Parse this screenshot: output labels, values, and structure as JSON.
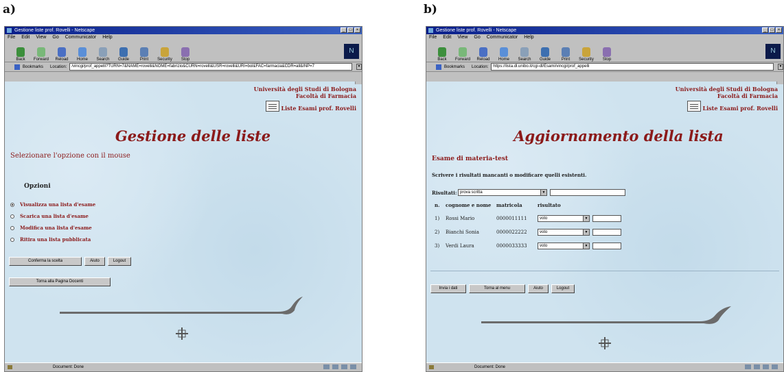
{
  "panels": [
    {
      "label": "a)",
      "window": {
        "title": "Gestione liste prof. Rovelli - Netscape",
        "menu": [
          "File",
          "Edit",
          "View",
          "Go",
          "Communicator",
          "Help"
        ],
        "toolbar": [
          "Back",
          "Forward",
          "Reload",
          "Home",
          "Search",
          "Guide",
          "Print",
          "Security",
          "Stop"
        ],
        "bookmarks_label": "Bookmarks",
        "location_label": "Location:",
        "url": "/vincgi/prof_appelli?TURN=7&NAME=rovelli&NOME=fabrizio&CURN=rovelli&USR=rovelli&URI=bol&FAC=farmacia&CDR=all&INP=7",
        "status": "Document: Done"
      },
      "page": {
        "university": "Università degli Studi di Bologna",
        "faculty": "Facoltà di Farmacia",
        "liste": "Liste Esami prof. Rovelli",
        "title": "Gestione delle liste",
        "subtitle": "Selezionare l'opzione con il mouse",
        "options_heading": "Opzioni",
        "options": [
          {
            "label": "Visualizza una lista d'esame",
            "selected": true
          },
          {
            "label": "Scarica una lista d'esame",
            "selected": false
          },
          {
            "label": "Modifica una lista d'esame",
            "selected": false
          },
          {
            "label": "Ritira una lista pubblicata",
            "selected": false
          }
        ],
        "buttons": {
          "confirm": "Conferma la scelta",
          "help": "Aiuto",
          "logout": "Logout",
          "back_docenti": "Torna alla Pagina Docenti"
        }
      }
    },
    {
      "label": "b)",
      "window": {
        "title": "Gestione liste prof. Rovelli - Netscape",
        "menu": [
          "File",
          "Edit",
          "View",
          "Go",
          "Communicator",
          "Help"
        ],
        "toolbar": [
          "Back",
          "Forward",
          "Reload",
          "Home",
          "Search",
          "Guide",
          "Print",
          "Security",
          "Stop"
        ],
        "bookmarks_label": "Bookmarks",
        "location_label": "Location:",
        "url": "https://lista.dl.unibo.it/cgi-dl/Esami/vincgi/prof_appelli",
        "status": "Document: Done"
      },
      "page": {
        "university": "Università degli Studi di Bologna",
        "faculty": "Facoltà di Farmacia",
        "liste": "Liste Esami prof. Rovelli",
        "title": "Aggiornamento della lista",
        "exam_title": "Esame di materia-test",
        "instructions": "Scrivere i risultati mancanti o modificare quelli esistenti.",
        "results_label": "Risultati:",
        "results_select": "prova scritta",
        "columns": [
          "n.",
          "cognome e nome",
          "matricola",
          "risultato"
        ],
        "rows": [
          {
            "n": "1)",
            "name": "Rossi Mario",
            "matricola": "0000011111",
            "voto": "voto"
          },
          {
            "n": "2)",
            "name": "Bianchi Sonia",
            "matricola": "0000022222",
            "voto": "voto"
          },
          {
            "n": "3)",
            "name": "Verdi Laura",
            "matricola": "0000033333",
            "voto": "voto"
          }
        ],
        "buttons": {
          "send": "Invia i dati",
          "menu": "Torna al menu",
          "help": "Aiuto",
          "logout": "Logout"
        }
      }
    }
  ],
  "colors": {
    "title_red": "#8b1a1a",
    "page_bg": "#cfe3ef",
    "titlebar": "#0a1f8a"
  }
}
